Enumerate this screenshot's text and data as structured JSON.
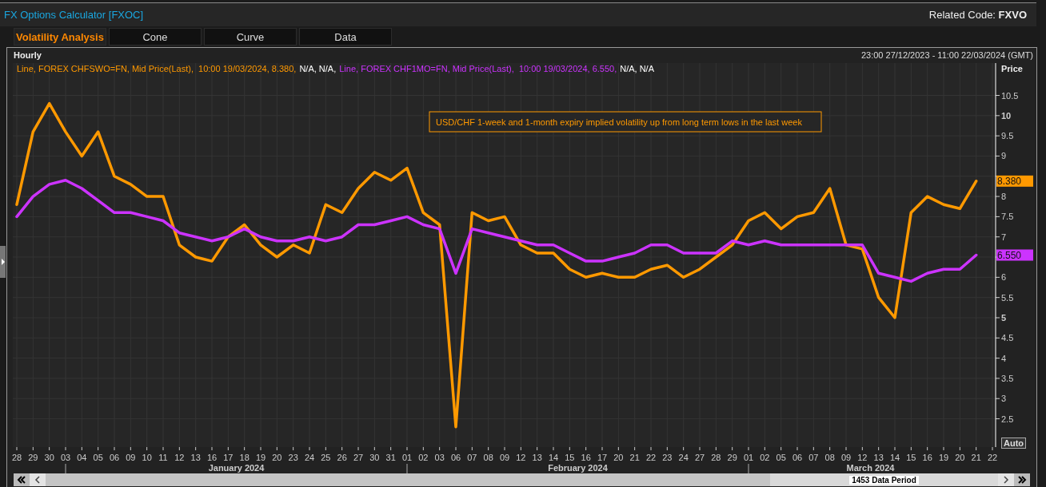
{
  "window": {
    "title": "FX Options Calculator [FXOC]",
    "related_label": "Related Code:",
    "related_code": "FXVO"
  },
  "tabs": [
    {
      "label": "Volatility Analysis",
      "selected": true
    },
    {
      "label": "Cone",
      "selected": false
    },
    {
      "label": "Curve",
      "selected": false
    },
    {
      "label": "Data",
      "selected": false
    }
  ],
  "chart": {
    "interval": "Hourly",
    "range": "23:00 27/12/2023 - 11:00 22/03/2024 (GMT)",
    "axis_title": "Price",
    "auto_button": "Auto",
    "legend_suffixes": [
      "N/A, N/A,",
      "N/A, N/A"
    ],
    "value_tags": [
      "8.380",
      "6.550"
    ],
    "month_labels": [
      "January 2024",
      "February 2024",
      "March 2024"
    ],
    "chart_data": {
      "type": "line",
      "categories": [
        "28",
        "29",
        "30",
        "03",
        "04",
        "05",
        "06",
        "09",
        "10",
        "11",
        "12",
        "13",
        "16",
        "17",
        "18",
        "19",
        "20",
        "23",
        "24",
        "25",
        "26",
        "27",
        "30",
        "31",
        "01",
        "02",
        "03",
        "06",
        "07",
        "08",
        "09",
        "12",
        "13",
        "14",
        "15",
        "16",
        "17",
        "20",
        "21",
        "22",
        "23",
        "24",
        "27",
        "28",
        "29",
        "01",
        "02",
        "05",
        "06",
        "07",
        "08",
        "09",
        "12",
        "13",
        "14",
        "15",
        "16",
        "19",
        "20",
        "21",
        "22"
      ],
      "series": [
        {
          "name": "Line, FOREX CHFSWO=FN, Mid Price(Last),  10:00 19/03/2024, 8.380,",
          "color": "#ff9900",
          "values": [
            7.8,
            9.6,
            10.3,
            9.6,
            9.0,
            9.6,
            8.5,
            8.3,
            8.0,
            8.0,
            6.8,
            6.5,
            6.4,
            7.0,
            7.3,
            6.8,
            6.5,
            6.8,
            6.6,
            7.8,
            7.6,
            8.2,
            8.6,
            8.4,
            8.7,
            7.6,
            7.3,
            2.3,
            7.6,
            7.4,
            7.5,
            6.8,
            6.6,
            6.6,
            6.2,
            6.0,
            6.1,
            6.0,
            6.0,
            6.2,
            6.3,
            6.0,
            6.2,
            6.5,
            6.8,
            7.4,
            7.6,
            7.2,
            7.5,
            7.6,
            8.2,
            6.8,
            6.7,
            5.5,
            5.0,
            7.6,
            8.0,
            7.8,
            7.7,
            8.38,
            null
          ]
        },
        {
          "name": "Line, FOREX CHF1MO=FN, Mid Price(Last),  10:00 19/03/2024, 6.550,",
          "color": "#cc33ff",
          "values": [
            7.5,
            8.0,
            8.3,
            8.4,
            8.2,
            7.9,
            7.6,
            7.6,
            7.5,
            7.4,
            7.1,
            7.0,
            6.9,
            7.0,
            7.2,
            7.0,
            6.9,
            6.9,
            7.0,
            6.9,
            7.0,
            7.3,
            7.3,
            7.4,
            7.5,
            7.3,
            7.2,
            6.1,
            7.2,
            7.1,
            7.0,
            6.9,
            6.8,
            6.8,
            6.6,
            6.4,
            6.4,
            6.5,
            6.6,
            6.8,
            6.8,
            6.6,
            6.6,
            6.6,
            6.9,
            6.8,
            6.9,
            6.8,
            6.8,
            6.8,
            6.8,
            6.8,
            6.8,
            6.1,
            6.0,
            5.9,
            6.1,
            6.2,
            6.2,
            6.55,
            null
          ]
        }
      ],
      "ylim": [
        1.8,
        11.3
      ],
      "yticks": [
        2.5,
        3,
        3.5,
        4,
        4.5,
        5,
        5.5,
        6,
        7,
        7.5,
        8,
        9,
        9.5,
        10,
        10.5
      ],
      "grid": true,
      "annotations": [
        {
          "text": "USD/CHF 1-week and 1-month expiry implied volatility up from long term lows in the last week"
        }
      ]
    }
  },
  "scrollbar": {
    "label": "1453 Data Period"
  }
}
